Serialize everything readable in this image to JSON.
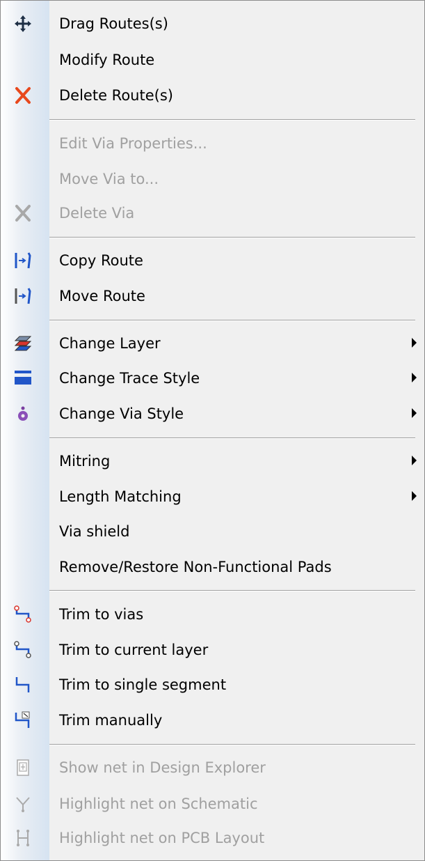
{
  "menu": {
    "items": [
      {
        "label": "Drag Routes(s)",
        "icon": "move-arrows-icon",
        "disabled": false,
        "submenu": false
      },
      {
        "label": "Modify Route",
        "icon": "",
        "disabled": false,
        "submenu": false
      },
      {
        "label": "Delete Route(s)",
        "icon": "red-x-icon",
        "disabled": false,
        "submenu": false
      },
      {
        "label": "Edit Via Properties...",
        "icon": "",
        "disabled": true,
        "submenu": false
      },
      {
        "label": "Move Via to...",
        "icon": "",
        "disabled": true,
        "submenu": false
      },
      {
        "label": "Delete Via",
        "icon": "gray-x-icon",
        "disabled": true,
        "submenu": false
      },
      {
        "label": "Copy Route",
        "icon": "copy-route-icon",
        "disabled": false,
        "submenu": false
      },
      {
        "label": "Move Route",
        "icon": "move-route-icon",
        "disabled": false,
        "submenu": false
      },
      {
        "label": "Change Layer",
        "icon": "layers-icon",
        "disabled": false,
        "submenu": true
      },
      {
        "label": "Change Trace Style",
        "icon": "trace-style-icon",
        "disabled": false,
        "submenu": true
      },
      {
        "label": "Change Via Style",
        "icon": "via-style-icon",
        "disabled": false,
        "submenu": true
      },
      {
        "label": "Mitring",
        "icon": "",
        "disabled": false,
        "submenu": true
      },
      {
        "label": "Length Matching",
        "icon": "",
        "disabled": false,
        "submenu": true
      },
      {
        "label": "Via shield",
        "icon": "",
        "disabled": false,
        "submenu": false
      },
      {
        "label": "Remove/Restore Non-Functional Pads",
        "icon": "",
        "disabled": false,
        "submenu": false
      },
      {
        "label": "Trim to vias",
        "icon": "trim-to-vias-icon",
        "disabled": false,
        "submenu": false
      },
      {
        "label": "Trim to current layer",
        "icon": "trim-to-layer-icon",
        "disabled": false,
        "submenu": false
      },
      {
        "label": "Trim to single segment",
        "icon": "trim-segment-icon",
        "disabled": false,
        "submenu": false
      },
      {
        "label": "Trim manually",
        "icon": "trim-manual-icon",
        "disabled": false,
        "submenu": false
      },
      {
        "label": "Show net in Design Explorer",
        "icon": "design-explorer-icon",
        "disabled": true,
        "submenu": false
      },
      {
        "label": "Highlight net on Schematic",
        "icon": "schematic-net-icon",
        "disabled": true,
        "submenu": false
      },
      {
        "label": "Highlight net on PCB Layout",
        "icon": "pcb-net-icon",
        "disabled": true,
        "submenu": false
      }
    ],
    "colors": {
      "accent_blue": "#2156c8",
      "delete_red": "#e8481c",
      "disabled_text": "#a0a0a0"
    }
  }
}
